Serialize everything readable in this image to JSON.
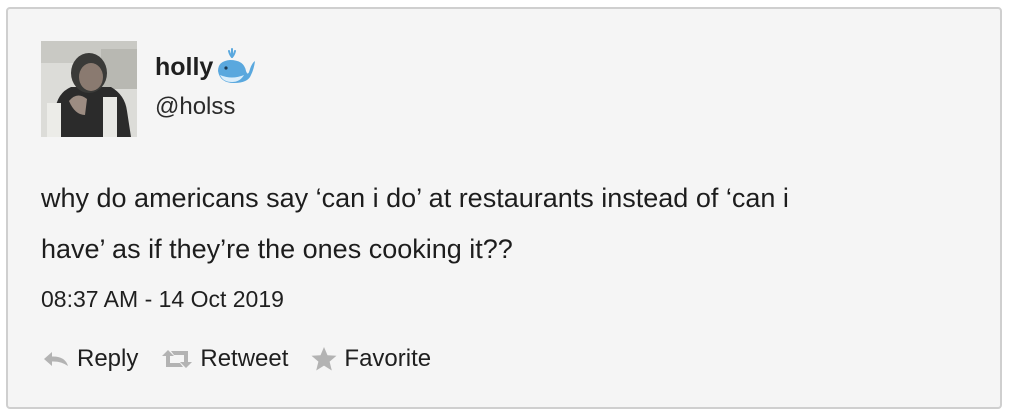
{
  "tweet": {
    "display_name": "holly",
    "display_name_emoji": "whale-icon",
    "handle": "@holss",
    "text": "why do americans say ‘can i do’ at restaurants instead of ‘can i\nhave’ as if they’re the ones cooking it??",
    "timestamp": "08:37 AM - 14 Oct 2019"
  },
  "actions": {
    "reply_label": "Reply",
    "retweet_label": "Retweet",
    "favorite_label": "Favorite"
  },
  "colors": {
    "card_background": "#f5f5f5",
    "card_border": "#cfcfcf",
    "text": "#1d1d1d",
    "icon_gray": "#b3b3b3",
    "whale_blue": "#5aa8de"
  }
}
